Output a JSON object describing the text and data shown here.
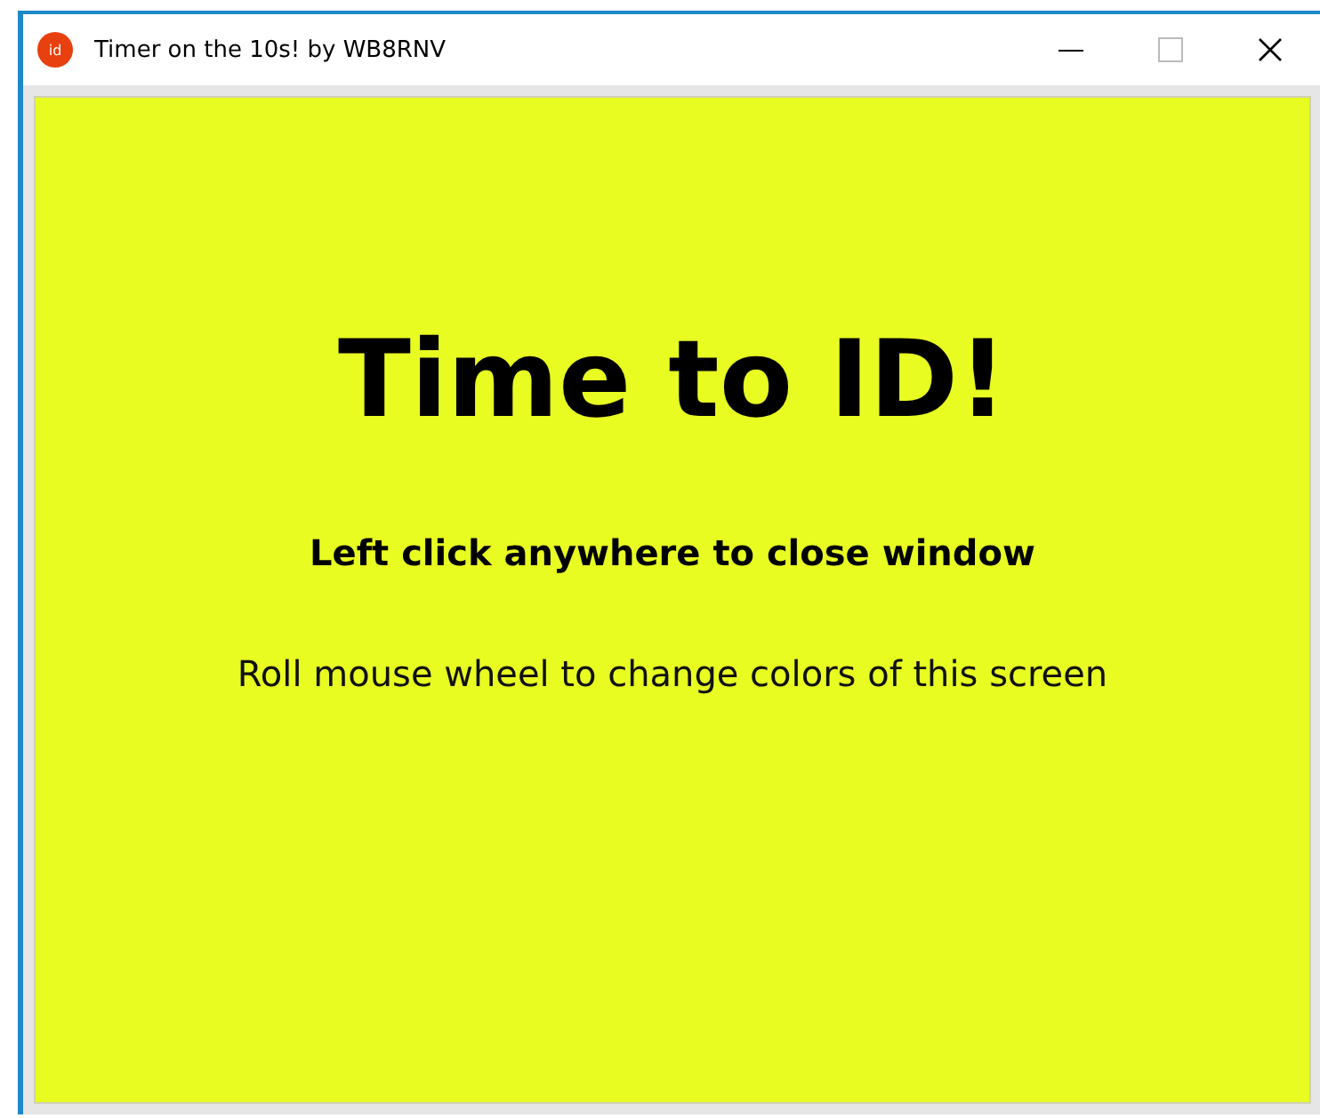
{
  "window": {
    "title": "Timer on the 10s! by WB8RNV",
    "icon_text": "id"
  },
  "screen": {
    "color": "#e8fc22",
    "heading": "Time to ID!",
    "instruction": "Left click anywhere to close window",
    "hint": "Roll mouse wheel to change colors of this screen"
  }
}
